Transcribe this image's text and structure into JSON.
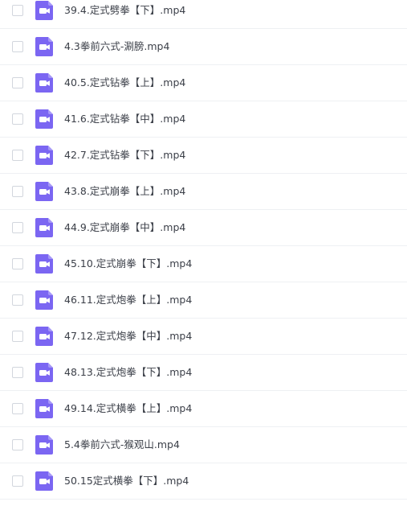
{
  "files": [
    {
      "name": "39.4.定式劈拳【下】.mp4",
      "icon": "video-file-icon"
    },
    {
      "name": "4.3拳前六式-涮膀.mp4",
      "icon": "video-file-icon"
    },
    {
      "name": "40.5.定式钻拳【上】.mp4",
      "icon": "video-file-icon"
    },
    {
      "name": "41.6.定式钻拳【中】.mp4",
      "icon": "video-file-icon"
    },
    {
      "name": "42.7.定式钻拳【下】.mp4",
      "icon": "video-file-icon"
    },
    {
      "name": "43.8.定式崩拳【上】.mp4",
      "icon": "video-file-icon"
    },
    {
      "name": "44.9.定式崩拳【中】.mp4",
      "icon": "video-file-icon"
    },
    {
      "name": "45.10.定式崩拳【下】.mp4",
      "icon": "video-file-icon"
    },
    {
      "name": "46.11.定式炮拳【上】.mp4",
      "icon": "video-file-icon"
    },
    {
      "name": "47.12.定式炮拳【中】.mp4",
      "icon": "video-file-icon"
    },
    {
      "name": "48.13.定式炮拳【下】.mp4",
      "icon": "video-file-icon"
    },
    {
      "name": "49.14.定式横拳【上】.mp4",
      "icon": "video-file-icon"
    },
    {
      "name": "5.4拳前六式-猴观山.mp4",
      "icon": "video-file-icon"
    },
    {
      "name": "50.15定式横拳【下】.mp4",
      "icon": "video-file-icon"
    }
  ],
  "colors": {
    "icon_bg": "#7b66f2",
    "icon_glyph": "#ffffff",
    "text": "#3b3f48",
    "divider": "#eef0f3",
    "checkbox_border": "#d2d6dd"
  }
}
